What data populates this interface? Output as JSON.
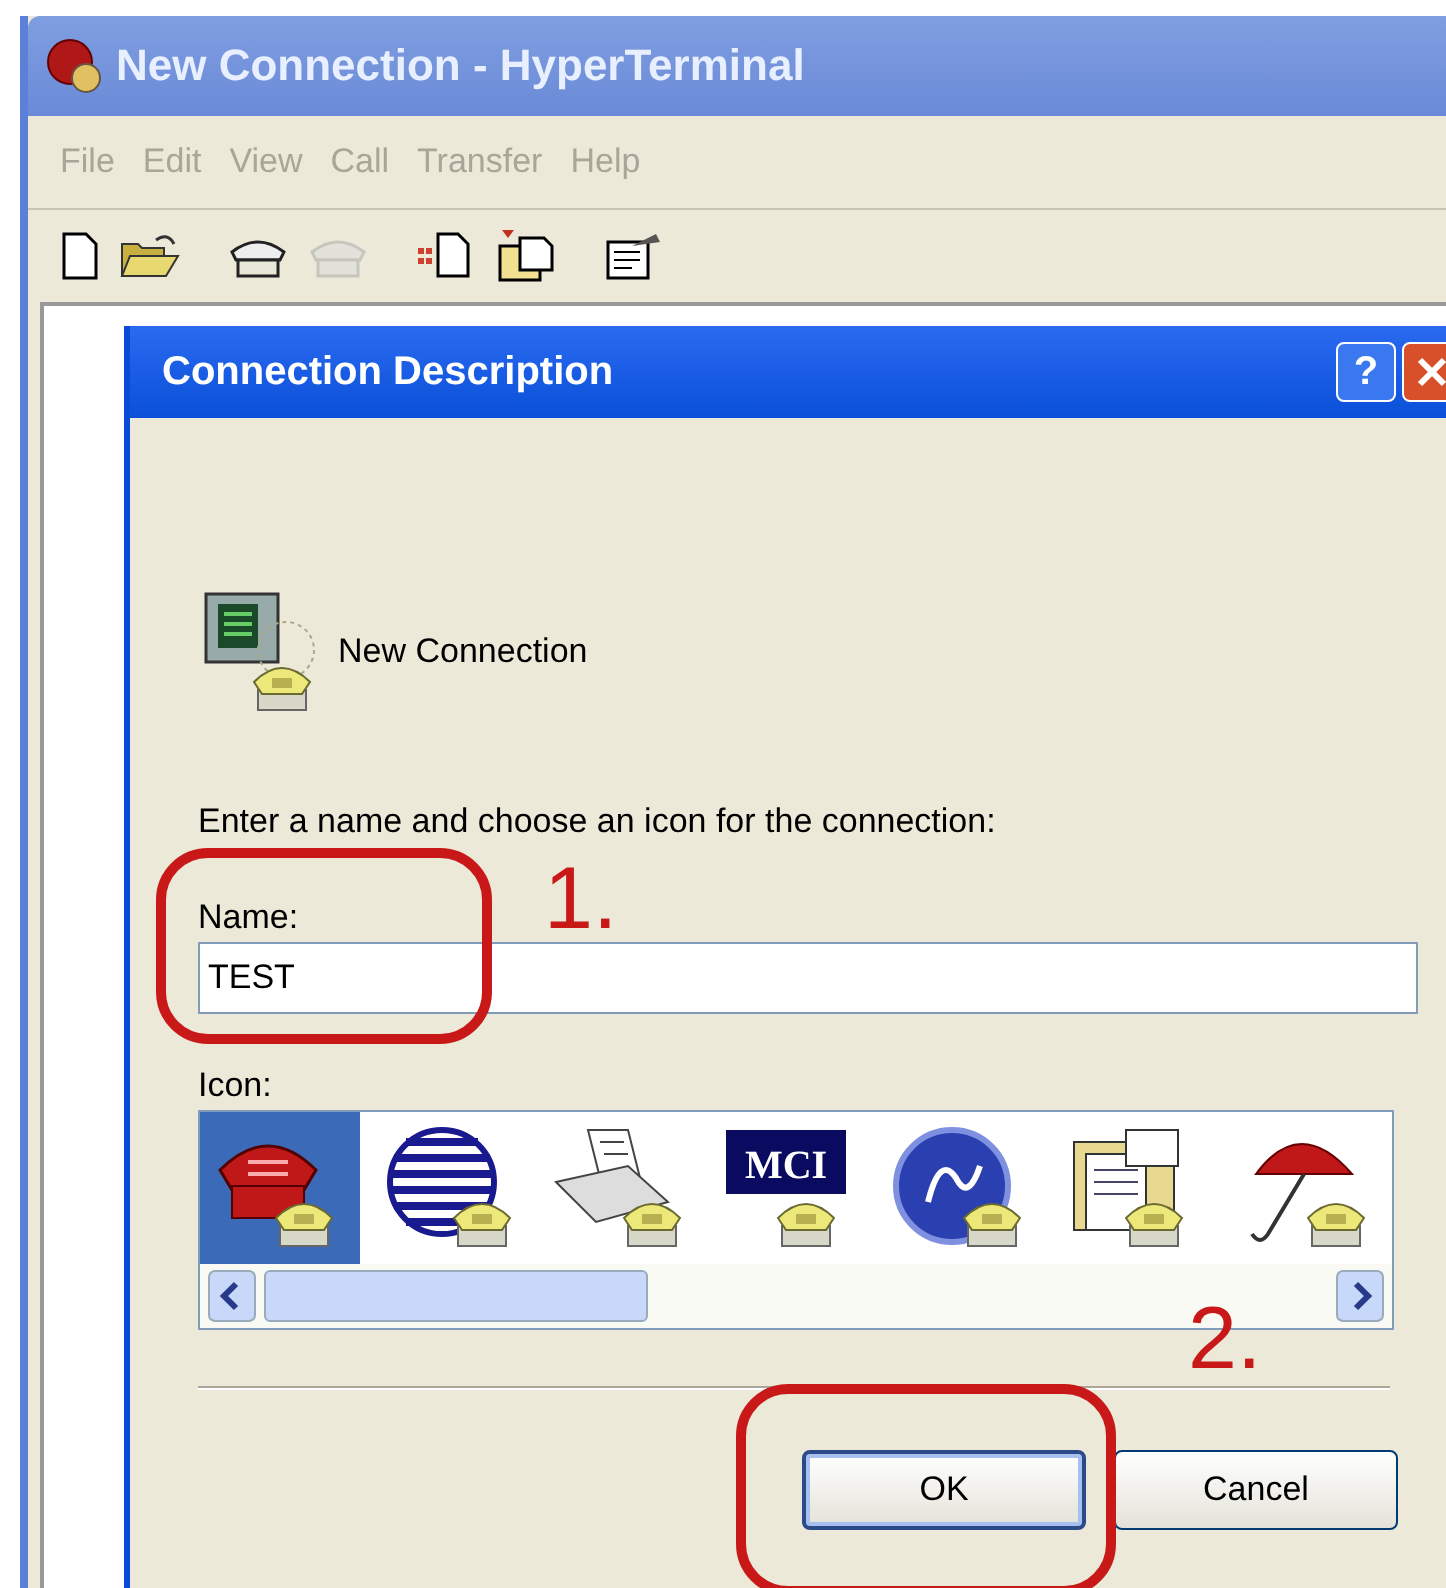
{
  "window": {
    "title": "New Connection - HyperTerminal"
  },
  "menu": [
    {
      "label": "File",
      "disabled": true
    },
    {
      "label": "Edit",
      "disabled": true
    },
    {
      "label": "View",
      "disabled": true
    },
    {
      "label": "Call",
      "disabled": true
    },
    {
      "label": "Transfer",
      "disabled": true
    },
    {
      "label": "Help",
      "disabled": true
    }
  ],
  "toolbar": [
    {
      "kind": "new",
      "disabled": false
    },
    {
      "kind": "open",
      "disabled": false
    },
    {
      "kind": "call",
      "disabled": false
    },
    {
      "kind": "disconnect",
      "disabled": true
    },
    {
      "kind": "send",
      "disabled": false
    },
    {
      "kind": "receive",
      "disabled": false
    },
    {
      "kind": "properties",
      "disabled": false
    }
  ],
  "dialog": {
    "title": "Connection Description",
    "help_button": "?",
    "heading": "New Connection",
    "prompt": "Enter a name and choose an icon for the connection:",
    "name_label": "Name:",
    "name_value": "TEST",
    "icon_label": "Icon:",
    "icons": [
      {
        "kind": "phone",
        "selected": true
      },
      {
        "kind": "globe",
        "selected": false
      },
      {
        "kind": "fax",
        "selected": false
      },
      {
        "kind": "logo",
        "label": "MCI",
        "selected": false
      },
      {
        "kind": "circle",
        "selected": false
      },
      {
        "kind": "documents",
        "selected": false
      },
      {
        "kind": "umbrella",
        "selected": false
      }
    ],
    "buttons": [
      {
        "label": "OK",
        "default": true
      },
      {
        "label": "Cancel",
        "default": false
      }
    ]
  },
  "annotations": [
    {
      "label": "1."
    },
    {
      "label": "2."
    }
  ]
}
